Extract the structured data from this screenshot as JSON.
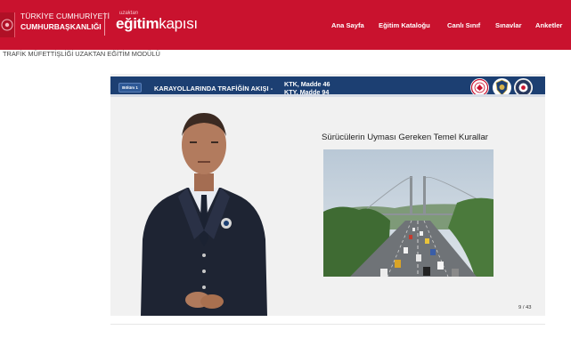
{
  "header": {
    "presidency_line1": "TÜRKİYE CUMHURİYETİ",
    "presidency_line2": "CUMHURBAŞKANLIĞI",
    "brand_small": "uzaktan",
    "brand_bold": "eğitim",
    "brand_light": "kapısı",
    "nav": [
      "Ana Sayfa",
      "Eğitim Kataloğu",
      "Canlı Sınıf",
      "Sınavlar",
      "Anketler"
    ],
    "colors": {
      "header_bg": "#c9122e",
      "banner_bg": "#1c3f72"
    }
  },
  "breadcrumb": "TRAFİK MÜFETTİŞLİĞİ UZAKTAN EĞİTİM MODÜLÜ",
  "slide": {
    "section_chip": "Bölüm 1",
    "title": "KARAYOLLARINDA TRAFİĞİN AKIŞI -",
    "ref1": "KTK, Madde 46",
    "ref2": "KTY, Madde 94",
    "heading": "Sürücülerin Uyması Gereken Temel Kurallar",
    "page": "9 / 43"
  }
}
